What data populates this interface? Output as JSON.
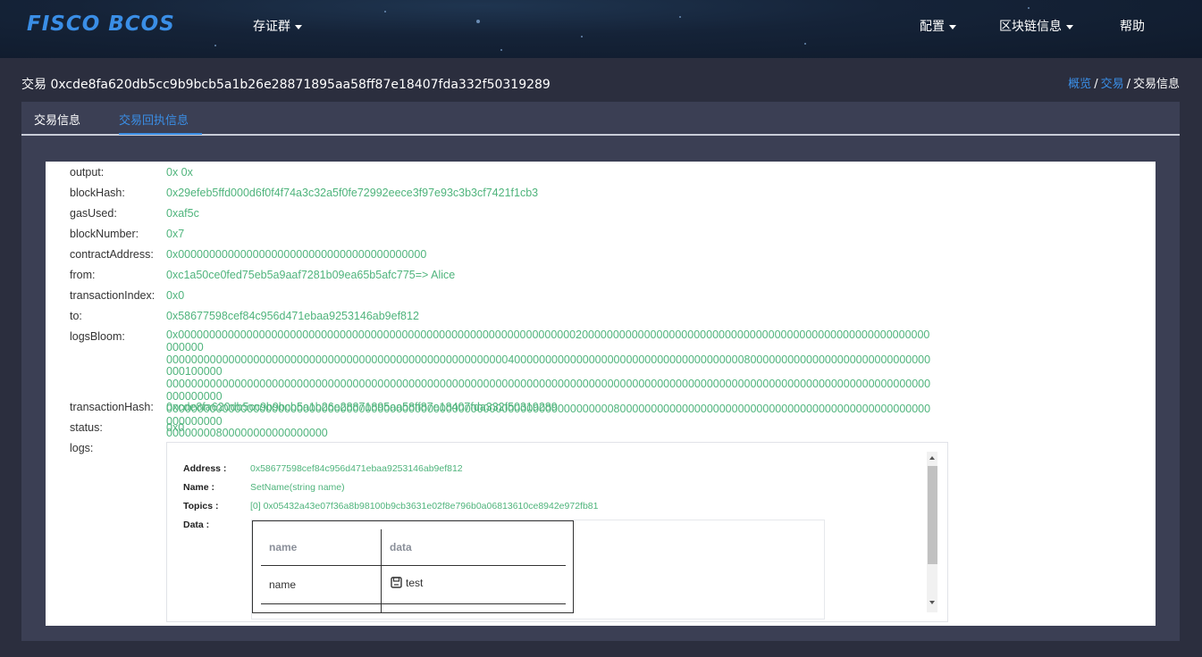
{
  "nav": {
    "logo": "FISCO BCOS",
    "group_menu": "存证群",
    "config_menu": "配置",
    "chain_menu": "区块链信息",
    "help": "帮助"
  },
  "header": {
    "title": "交易 0xcde8fa620db5cc9b9bcb5a1b26e28871895aa58ff87e18407fda332f50319289",
    "breadcrumb": {
      "overview": "概览",
      "sep": "/",
      "tx": "交易",
      "current": "交易信息"
    }
  },
  "tabs": {
    "tx_info": "交易信息",
    "receipt": "交易回执信息"
  },
  "receipt": {
    "fields": [
      {
        "key": "output:",
        "value": "0x 0x"
      },
      {
        "key": "blockHash:",
        "value": "0x29efeb5ffd000d6f0f4f74a3c32a5f0fe72992eece3f97e93c3b3cf7421f1cb3"
      },
      {
        "key": "gasUsed:",
        "value": "0xaf5c"
      },
      {
        "key": "blockNumber:",
        "value": "0x7"
      },
      {
        "key": "contractAddress:",
        "value": "0x0000000000000000000000000000000000000000"
      },
      {
        "key": "from:",
        "value": "0xc1a50ce0fed75eb5a9aaf7281b09ea65b5afc775=> Alice"
      },
      {
        "key": "transactionIndex:",
        "value": "0x0"
      },
      {
        "key": "to:",
        "value": "0x58677598cef84c956d471ebaa9253146ab9ef812"
      }
    ],
    "logsBloom_key": "logsBloom:",
    "logsBloom_lines": [
      "0x0000000000000000000000000000000000000000000000000000000000000000200000000000000000000000000000000000000000000000000000000000000",
      "000000000000000000000000000000000000000000000000000000040000000000000000000000000000000000000800000000000000000000000000000000100000",
      "000000000000000000000000000000000000000000000000000000000000000000000000000000000000000000000000000000000000000000000000000000000000",
      "000000000000000000000000000000000000000000000000000000000000000000000000800000000000000000000000000000000000000000000000000000000000",
      "00000000800000000000000000"
    ],
    "transactionHash": {
      "key": "transactionHash:",
      "value": "0xcde8fa620db5cc9b9bcb5a1b26e28871895aa58ff87e18407fda332f50319289"
    },
    "status": {
      "key": "status:",
      "value": "0x0"
    },
    "logs_key": "logs:",
    "log": {
      "address_label": "Address :",
      "address": "0x58677598cef84c956d471ebaa9253146ab9ef812",
      "name_label": "Name :",
      "name": "SetName(string name)",
      "topics_label": "Topics :",
      "topics": "[0] 0x05432a43e07f36a8b98100b9cb3631e02f8e796b0a06813610ce8942e972fb81",
      "data_label": "Data :",
      "table": {
        "headers": [
          "name",
          "data"
        ],
        "rows": [
          {
            "name": "name",
            "data": "test"
          }
        ]
      }
    }
  }
}
